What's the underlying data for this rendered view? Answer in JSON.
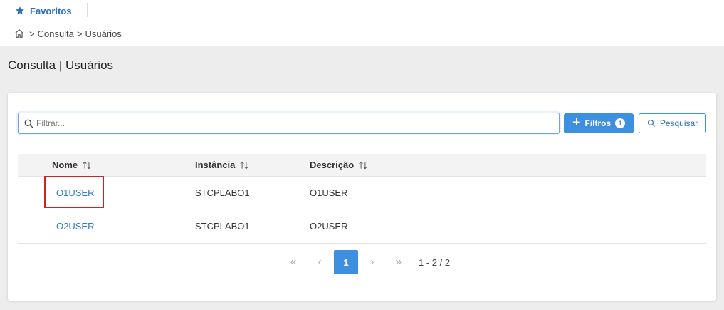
{
  "topbar": {
    "favorites_label": "Favoritos"
  },
  "breadcrumb": {
    "items": [
      "Consulta",
      "Usuários"
    ],
    "separator": ">"
  },
  "page": {
    "title": "Consulta | Usuários"
  },
  "filter": {
    "placeholder": "Filtrar...",
    "value": ""
  },
  "buttons": {
    "filtros_label": "Filtros",
    "filtros_count": "1",
    "pesquisar_label": "Pesquisar"
  },
  "table": {
    "columns": [
      "Nome",
      "Instância",
      "Descrição"
    ],
    "rows": [
      {
        "nome": "O1USER",
        "instancia": "STCPLABO1",
        "descricao": "O1USER"
      },
      {
        "nome": "O2USER",
        "instancia": "STCPLABO1",
        "descricao": "O2USER"
      }
    ]
  },
  "pagination": {
    "first": "«",
    "prev": "‹",
    "current": "1",
    "next": "›",
    "last": "»",
    "info": "1 - 2 / 2"
  },
  "colors": {
    "accent": "#3d8fe0",
    "link": "#2f7ad0",
    "highlight": "#d62020"
  },
  "icons": {
    "favorites": "star-icon",
    "home": "home-icon",
    "search": "search-icon",
    "sort": "sort-icon"
  }
}
